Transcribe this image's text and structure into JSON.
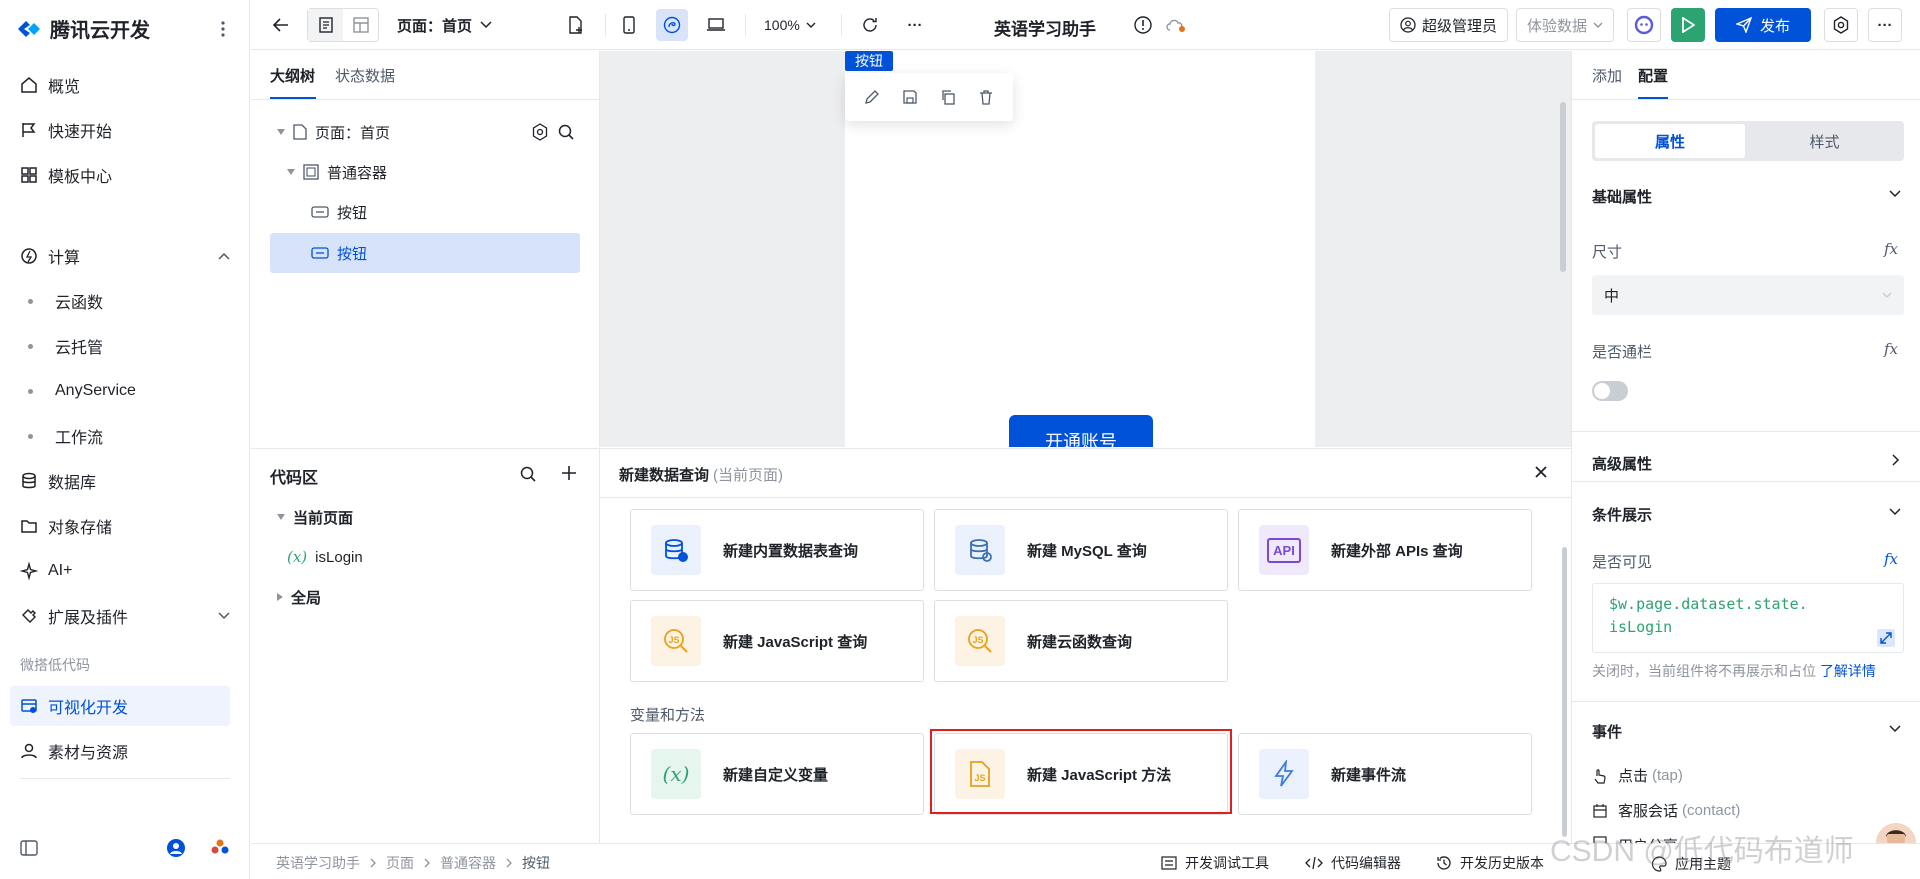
{
  "app": {
    "brand": "腾讯云开发"
  },
  "nav": {
    "overview": "概览",
    "quickstart": "快速开始",
    "templates": "模板中心",
    "compute": "计算",
    "cloud_functions": "云函数",
    "cloud_hosting": "云托管",
    "anyservice": "AnyService",
    "workflow": "工作流",
    "database": "数据库",
    "object_storage": "对象存储",
    "ai": "AI+",
    "extensions": "扩展及插件",
    "group_lowcode": "微搭低代码",
    "visual_dev": "可视化开发",
    "assets": "素材与资源"
  },
  "toolbar": {
    "page_selector": "页面：首页",
    "zoom": "100%",
    "more": "···",
    "app_title": "英语学习助手",
    "admin": "超级管理员",
    "data_mode": "体验数据",
    "publish": "发布"
  },
  "outline": {
    "tab_outline": "大纲树",
    "tab_state": "状态数据",
    "page_node": "页面：首页",
    "container_node": "普通容器",
    "button1": "按钮",
    "button2": "按钮"
  },
  "canvas": {
    "selected_tag": "按钮",
    "button_text": "开通账号"
  },
  "codearea": {
    "title": "代码区",
    "current_page": "当前页面",
    "var_prefix": "(x)",
    "var_name": "isLogin",
    "global": "全局"
  },
  "query_panel": {
    "title": "新建数据查询",
    "subtitle": "(当前页面)",
    "cards_row1": [
      "新建内置数据表查询",
      "新建 MySQL 查询",
      "新建外部 APIs 查询"
    ],
    "cards_row2": [
      "新建 JavaScript 查询",
      "新建云函数查询"
    ],
    "section_vars": "变量和方法",
    "cards_row3": [
      "新建自定义变量",
      "新建 JavaScript 方法",
      "新建事件流"
    ],
    "api_label": "API",
    "x_label": "(x)"
  },
  "right_panel": {
    "tab_add": "添加",
    "tab_config": "配置",
    "seg_props": "属性",
    "seg_style": "样式",
    "basic_props": "基础属性",
    "size_label": "尺寸",
    "size_value": "中",
    "fullwidth_label": "是否通栏",
    "advanced_props": "高级属性",
    "conditional": "条件展示",
    "visible_label": "是否可见",
    "visible_expr_1": "$w.page.dataset.state.",
    "visible_expr_2": "isLogin",
    "hint": "关闭时，当前组件将不再展示和占位",
    "hint_link": "了解详情",
    "events": "事件",
    "event_tap": "点击",
    "event_tap_code": "(tap)",
    "event_contact": "客服会话",
    "event_contact_code": "(contact)",
    "event_share_partial": "用户分享",
    "fx": "fx"
  },
  "statusbar": {
    "breadcrumb": [
      "英语学习助手",
      "页面",
      "普通容器",
      "按钮"
    ],
    "debug_tools": "开发调试工具",
    "code_editor": "代码编辑器",
    "history": "开发历史版本",
    "theme": "应用主题"
  },
  "watermark": "CSDN @低代码布道师",
  "colors": {
    "primary": "#0052d9",
    "run_green": "#2ba471",
    "highlight_red": "#e02020"
  }
}
